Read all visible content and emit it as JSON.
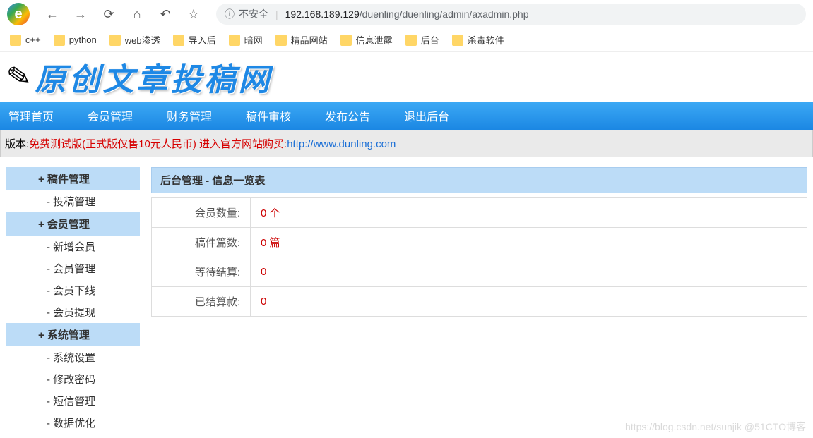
{
  "browser": {
    "security_label": "不安全",
    "url_host": "192.168.189.129",
    "url_path": "/duenling/duenling/admin/axadmin.php"
  },
  "bookmarks": [
    "c++",
    "python",
    "web渗透",
    "导入后",
    "暗网",
    "精品网站",
    "信息泄露",
    "后台",
    "杀毒软件"
  ],
  "logo_text": "原创文章投稿网",
  "nav": [
    "管理首页",
    "会员管理",
    "财务管理",
    "稿件审核",
    "发布公告",
    "退出后台"
  ],
  "version": {
    "prefix": "版本:",
    "red_text": "免费测试版(正式版仅售10元人民币) 进入官方网站购买:",
    "link": "http://www.dunling.com"
  },
  "sidebar": [
    {
      "type": "head",
      "label": "+ 稿件管理"
    },
    {
      "type": "item",
      "label": "- 投稿管理"
    },
    {
      "type": "head",
      "label": "+ 会员管理"
    },
    {
      "type": "item",
      "label": "- 新增会员"
    },
    {
      "type": "item",
      "label": "- 会员管理"
    },
    {
      "type": "item",
      "label": "- 会员下线"
    },
    {
      "type": "item",
      "label": "- 会员提现"
    },
    {
      "type": "head",
      "label": "+ 系统管理"
    },
    {
      "type": "item",
      "label": "- 系统设置"
    },
    {
      "type": "item",
      "label": "- 修改密码"
    },
    {
      "type": "item",
      "label": "- 短信管理"
    },
    {
      "type": "item",
      "label": "- 数据优化"
    }
  ],
  "panel_title": "后台管理 - 信息一览表",
  "info_rows": [
    {
      "label": "会员数量:",
      "value": "0 个"
    },
    {
      "label": "稿件篇数:",
      "value": "0 篇"
    },
    {
      "label": "等待结算:",
      "value": "0"
    },
    {
      "label": "已结算款:",
      "value": "0"
    }
  ],
  "watermark": "https://blog.csdn.net/sunjik  @51CTO博客"
}
